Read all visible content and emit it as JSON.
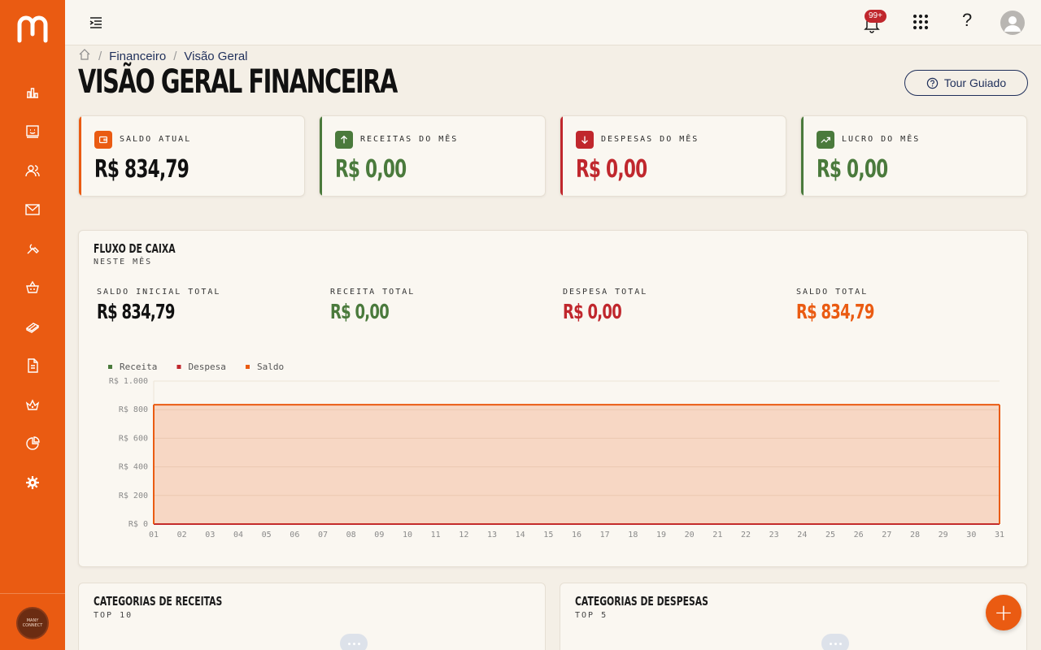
{
  "app": {
    "logo_letter": "m"
  },
  "sidebar": {
    "items": [
      {
        "icon": "dashboard-icon"
      },
      {
        "icon": "smiley-board-icon"
      },
      {
        "icon": "users-icon"
      },
      {
        "icon": "mail-icon"
      },
      {
        "icon": "tools-icon"
      },
      {
        "icon": "basket-icon"
      },
      {
        "icon": "money-icon"
      },
      {
        "icon": "document-icon"
      },
      {
        "icon": "crown-basket-icon"
      },
      {
        "icon": "pie-chart-icon"
      },
      {
        "icon": "gear-icon"
      }
    ],
    "brand_text": "MANY\nCONNECT",
    "accent_color": "#ea5b12"
  },
  "topbar": {
    "notifications_badge": "99+",
    "help_label": "?"
  },
  "breadcrumb": {
    "items": [
      "Financeiro",
      "Visão Geral"
    ]
  },
  "page": {
    "title": "VISÃO GERAL FINANCEIRA",
    "tour_button": "Tour Guiado"
  },
  "cards": [
    {
      "label": "SALDO ATUAL",
      "value": "R$ 834,79",
      "color": "#ea5b12",
      "value_color": "#111111",
      "icon": "wallet-icon"
    },
    {
      "label": "RECEITAS DO MÊS",
      "value": "R$ 0,00",
      "color": "#4a7a3c",
      "value_color": "#4a7a3c",
      "icon": "arrow-up-icon"
    },
    {
      "label": "DESPESAS DO MÊS",
      "value": "R$ 0,00",
      "color": "#c0272d",
      "value_color": "#c0272d",
      "icon": "arrow-down-icon"
    },
    {
      "label": "LUCRO DO MÊS",
      "value": "R$ 0,00",
      "color": "#4a7a3c",
      "value_color": "#4a7a3c",
      "icon": "trend-up-icon"
    }
  ],
  "cashflow": {
    "title": "FLUXO DE CAIXA",
    "subtitle": "NESTE MÊS",
    "stats": [
      {
        "label": "SALDO INICIAL TOTAL",
        "value": "R$ 834,79",
        "color": "#111111"
      },
      {
        "label": "RECEITA TOTAL",
        "value": "R$ 0,00",
        "color": "#4a7a3c"
      },
      {
        "label": "DESPESA TOTAL",
        "value": "R$ 0,00",
        "color": "#c0272d"
      },
      {
        "label": "SALDO TOTAL",
        "value": "R$ 834,79",
        "color": "#ea5b12"
      }
    ]
  },
  "chart_data": {
    "type": "area",
    "legend": [
      {
        "name": "Receita",
        "color": "#4a7a3c"
      },
      {
        "name": "Despesa",
        "color": "#c0272d"
      },
      {
        "name": "Saldo",
        "color": "#ea5b12"
      }
    ],
    "x": [
      "01",
      "02",
      "03",
      "04",
      "05",
      "06",
      "07",
      "08",
      "09",
      "10",
      "11",
      "12",
      "13",
      "14",
      "15",
      "16",
      "17",
      "18",
      "19",
      "20",
      "21",
      "22",
      "23",
      "24",
      "25",
      "26",
      "27",
      "28",
      "29",
      "30",
      "31"
    ],
    "series": [
      {
        "name": "Receita",
        "values": [
          0,
          0,
          0,
          0,
          0,
          0,
          0,
          0,
          0,
          0,
          0,
          0,
          0,
          0,
          0,
          0,
          0,
          0,
          0,
          0,
          0,
          0,
          0,
          0,
          0,
          0,
          0,
          0,
          0,
          0,
          0
        ]
      },
      {
        "name": "Despesa",
        "values": [
          0,
          0,
          0,
          0,
          0,
          0,
          0,
          0,
          0,
          0,
          0,
          0,
          0,
          0,
          0,
          0,
          0,
          0,
          0,
          0,
          0,
          0,
          0,
          0,
          0,
          0,
          0,
          0,
          0,
          0,
          0
        ]
      },
      {
        "name": "Saldo",
        "values": [
          834.79,
          834.79,
          834.79,
          834.79,
          834.79,
          834.79,
          834.79,
          834.79,
          834.79,
          834.79,
          834.79,
          834.79,
          834.79,
          834.79,
          834.79,
          834.79,
          834.79,
          834.79,
          834.79,
          834.79,
          834.79,
          834.79,
          834.79,
          834.79,
          834.79,
          834.79,
          834.79,
          834.79,
          834.79,
          834.79,
          834.79
        ]
      }
    ],
    "yticks": [
      "R$ 0",
      "R$ 200",
      "R$ 400",
      "R$ 600",
      "R$ 800",
      "R$ 1.000"
    ],
    "ylim": [
      0,
      1000
    ],
    "legend_position": "top-left",
    "grid": true
  },
  "bottom": [
    {
      "title": "CATEGORIAS DE RECEITAS",
      "subtitle": "TOP 10"
    },
    {
      "title": "CATEGORIAS DE DESPESAS",
      "subtitle": "TOP 5"
    }
  ],
  "fab": {
    "label": "+"
  }
}
